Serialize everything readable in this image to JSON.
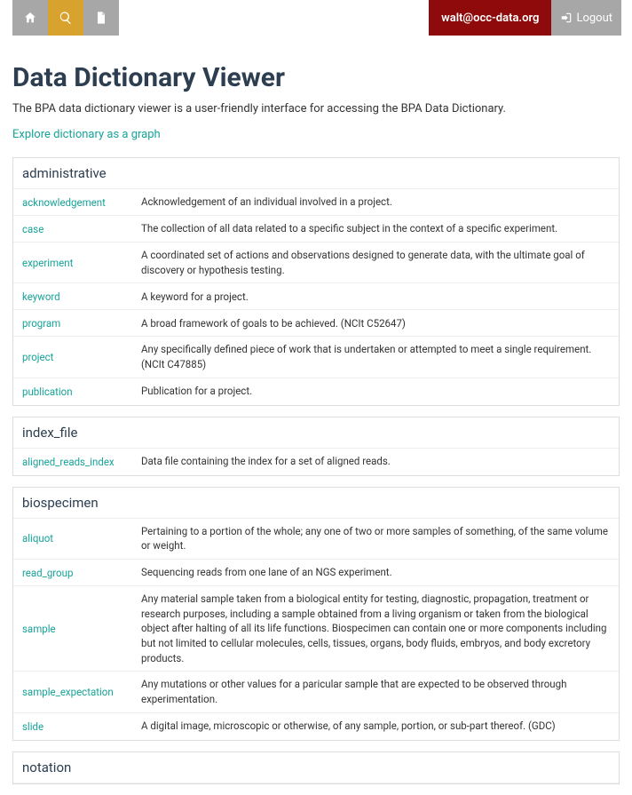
{
  "header": {
    "user_email": "walt@occ-data.org",
    "logout_label": "Logout"
  },
  "page": {
    "title": "Data Dictionary Viewer",
    "subtitle": "The BPA data dictionary viewer is a user-friendly interface for accessing the BPA Data Dictionary.",
    "explore_link": "Explore dictionary as a graph"
  },
  "sections": [
    {
      "title": "administrative",
      "rows": [
        {
          "term": "acknowledgement",
          "desc": "Acknowledgement of an individual involved in a project."
        },
        {
          "term": "case",
          "desc": "The collection of all data related to a specific subject in the context of a specific experiment."
        },
        {
          "term": "experiment",
          "desc": "A coordinated set of actions and observations designed to generate data, with the ultimate goal of discovery or hypothesis testing."
        },
        {
          "term": "keyword",
          "desc": "A keyword for a project."
        },
        {
          "term": "program",
          "desc": "A broad framework of goals to be achieved. (NCIt C52647)"
        },
        {
          "term": "project",
          "desc": "Any specifically defined piece of work that is undertaken or attempted to meet a single requirement. (NCIt C47885)"
        },
        {
          "term": "publication",
          "desc": "Publication for a project."
        }
      ]
    },
    {
      "title": "index_file",
      "rows": [
        {
          "term": "aligned_reads_index",
          "desc": "Data file containing the index for a set of aligned reads."
        }
      ]
    },
    {
      "title": "biospecimen",
      "rows": [
        {
          "term": "aliquot",
          "desc": "Pertaining to a portion of the whole; any one of two or more samples of something, of the same volume or weight."
        },
        {
          "term": "read_group",
          "desc": "Sequencing reads from one lane of an NGS experiment."
        },
        {
          "term": "sample",
          "desc": "Any material sample taken from a biological entity for testing, diagnostic, propagation, treatment or research purposes, including a sample obtained from a living organism or taken from the biological object after halting of all its life functions. Biospecimen can contain one or more components including but not limited to cellular molecules, cells, tissues, organs, body fluids, embryos, and body excretory products."
        },
        {
          "term": "sample_expectation",
          "desc": "Any mutations or other values for a paricular sample that are expected to be observed through experimentation."
        },
        {
          "term": "slide",
          "desc": "A digital image, microscopic or otherwise, of any sample, portion, or sub-part thereof. (GDC)"
        }
      ]
    },
    {
      "title": "notation",
      "rows": []
    }
  ]
}
